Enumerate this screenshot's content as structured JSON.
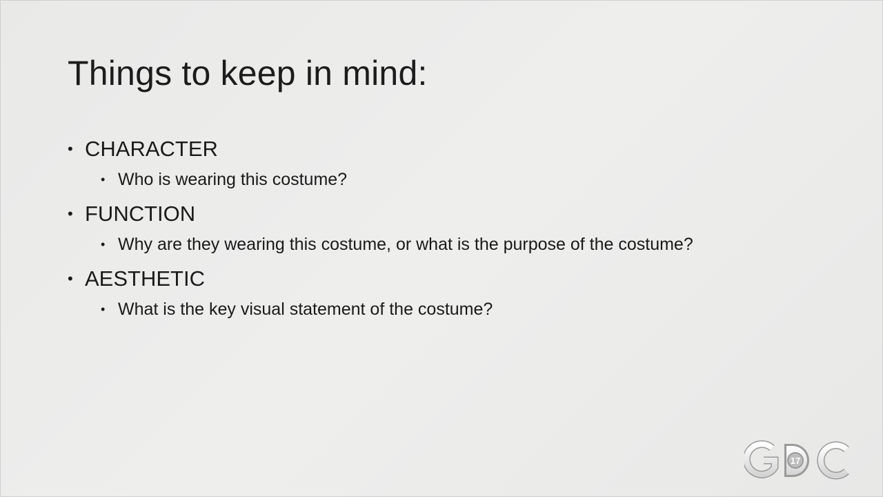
{
  "slide": {
    "title": "Things to keep in mind:",
    "bullets": [
      {
        "label": "CHARACTER",
        "sub": "Who is wearing this costume?"
      },
      {
        "label": "FUNCTION",
        "sub": "Why are they wearing this costume, or what is the purpose of the costume?"
      },
      {
        "label": "AESTHETIC",
        "sub": "What is the key visual statement of the costume?"
      }
    ],
    "bullet_glyph": "•"
  },
  "logo": {
    "text": "GDC",
    "year": "17",
    "icon": "gdc-logo-icon"
  },
  "colors": {
    "background": "#ebebea",
    "text": "#1a1a1a"
  }
}
